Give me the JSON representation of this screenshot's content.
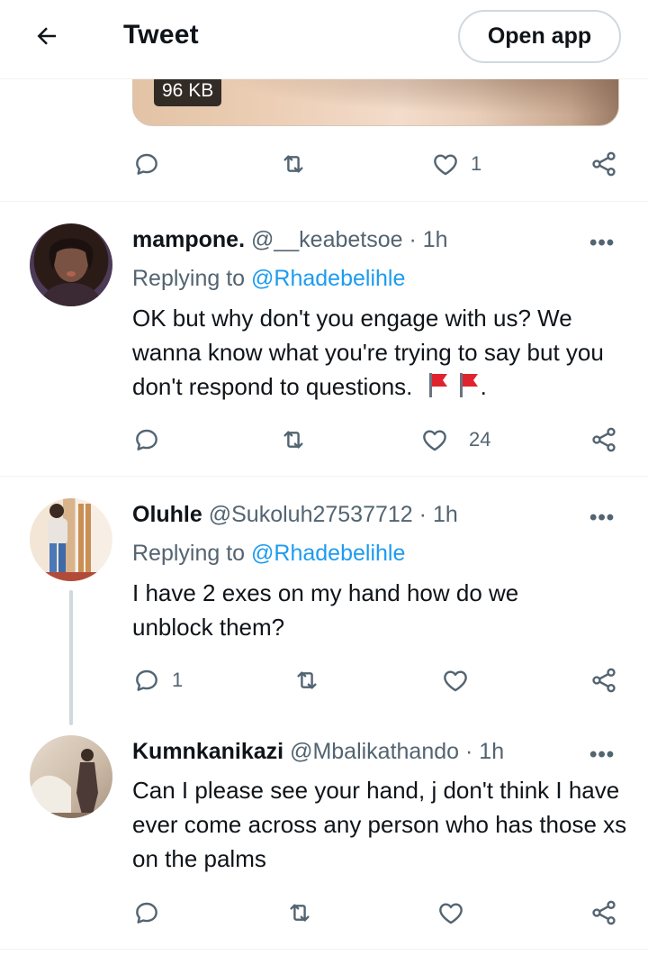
{
  "header": {
    "title": "Tweet",
    "open_app_label": "Open app"
  },
  "top_media": {
    "size_badge": "96 KB"
  },
  "top_actions": {
    "like_count": "1"
  },
  "tweets": [
    {
      "name": "mampone.",
      "handle": "@__keabetsoe",
      "time": "1h",
      "replying_prefix": "Replying to",
      "replying_to": "@Rhadebelihle",
      "text": "OK but why don't you engage with us? We wanna know what you're trying to say but you don't respond to questions.",
      "text_suffix": ".",
      "reply_count": "",
      "like_count": "24"
    },
    {
      "name": "Oluhle",
      "handle": "@Sukoluh27537712",
      "time": "1h",
      "replying_prefix": "Replying to",
      "replying_to": "@Rhadebelihle",
      "text": "I have 2 exes on my hand how do we unblock them?",
      "reply_count": "1",
      "like_count": ""
    },
    {
      "name": "Kumnkanikazi",
      "handle": "@Mbalikathando",
      "time": "1h",
      "text": "Can I please  see your hand, j don't think I have ever come across any person who has those xs on the palms",
      "reply_count": "",
      "like_count": ""
    }
  ],
  "separator": "·",
  "more_glyph": "•••",
  "icons": [
    "back-arrow-icon",
    "reply-icon",
    "retweet-icon",
    "like-icon",
    "share-icon",
    "more-icon",
    "red-flag-icon"
  ],
  "colors": {
    "link": "#1d9bf0",
    "muted": "#536471",
    "text": "#0f1419",
    "border": "#eff3f4",
    "flag": "#e0242f"
  }
}
